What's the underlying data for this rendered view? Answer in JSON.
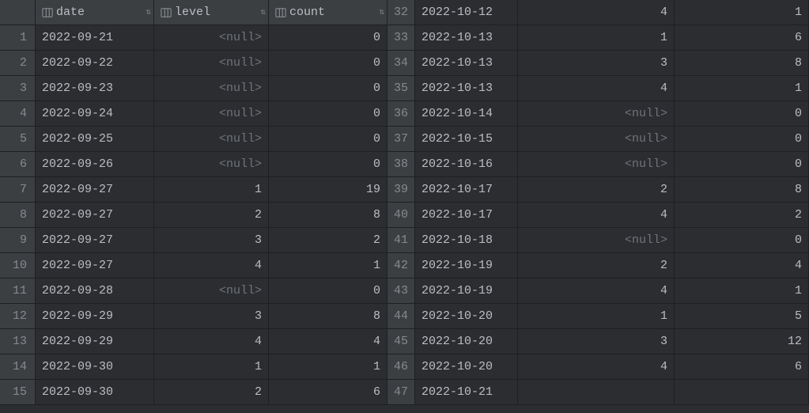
{
  "columns": [
    {
      "name": "date",
      "align": "left"
    },
    {
      "name": "level",
      "align": "right"
    },
    {
      "name": "count",
      "align": "right"
    }
  ],
  "null_text": "<null>",
  "sort_glyph": "⇅",
  "left_rows": [
    {
      "n": 1,
      "date": "2022-09-21",
      "level": null,
      "count": 0
    },
    {
      "n": 2,
      "date": "2022-09-22",
      "level": null,
      "count": 0
    },
    {
      "n": 3,
      "date": "2022-09-23",
      "level": null,
      "count": 0
    },
    {
      "n": 4,
      "date": "2022-09-24",
      "level": null,
      "count": 0
    },
    {
      "n": 5,
      "date": "2022-09-25",
      "level": null,
      "count": 0
    },
    {
      "n": 6,
      "date": "2022-09-26",
      "level": null,
      "count": 0
    },
    {
      "n": 7,
      "date": "2022-09-27",
      "level": 1,
      "count": 19
    },
    {
      "n": 8,
      "date": "2022-09-27",
      "level": 2,
      "count": 8
    },
    {
      "n": 9,
      "date": "2022-09-27",
      "level": 3,
      "count": 2
    },
    {
      "n": 10,
      "date": "2022-09-27",
      "level": 4,
      "count": 1
    },
    {
      "n": 11,
      "date": "2022-09-28",
      "level": null,
      "count": 0
    },
    {
      "n": 12,
      "date": "2022-09-29",
      "level": 3,
      "count": 8
    },
    {
      "n": 13,
      "date": "2022-09-29",
      "level": 4,
      "count": 4
    },
    {
      "n": 14,
      "date": "2022-09-30",
      "level": 1,
      "count": 1
    },
    {
      "n": 15,
      "date": "2022-09-30",
      "level": 2,
      "count": 6
    }
  ],
  "right_rows": [
    {
      "n": 32,
      "date": "2022-10-12",
      "level": 4,
      "count": 1
    },
    {
      "n": 33,
      "date": "2022-10-13",
      "level": 1,
      "count": 6
    },
    {
      "n": 34,
      "date": "2022-10-13",
      "level": 3,
      "count": 8
    },
    {
      "n": 35,
      "date": "2022-10-13",
      "level": 4,
      "count": 1
    },
    {
      "n": 36,
      "date": "2022-10-14",
      "level": null,
      "count": 0
    },
    {
      "n": 37,
      "date": "2022-10-15",
      "level": null,
      "count": 0
    },
    {
      "n": 38,
      "date": "2022-10-16",
      "level": null,
      "count": 0
    },
    {
      "n": 39,
      "date": "2022-10-17",
      "level": 2,
      "count": 8
    },
    {
      "n": 40,
      "date": "2022-10-17",
      "level": 4,
      "count": 2
    },
    {
      "n": 41,
      "date": "2022-10-18",
      "level": null,
      "count": 0
    },
    {
      "n": 42,
      "date": "2022-10-19",
      "level": 2,
      "count": 4
    },
    {
      "n": 43,
      "date": "2022-10-19",
      "level": 4,
      "count": 1
    },
    {
      "n": 44,
      "date": "2022-10-20",
      "level": 1,
      "count": 5
    },
    {
      "n": 45,
      "date": "2022-10-20",
      "level": 3,
      "count": 12
    },
    {
      "n": 46,
      "date": "2022-10-20",
      "level": 4,
      "count": 6
    },
    {
      "n": 47,
      "date": "2022-10-21",
      "level": "",
      "count": ""
    }
  ]
}
